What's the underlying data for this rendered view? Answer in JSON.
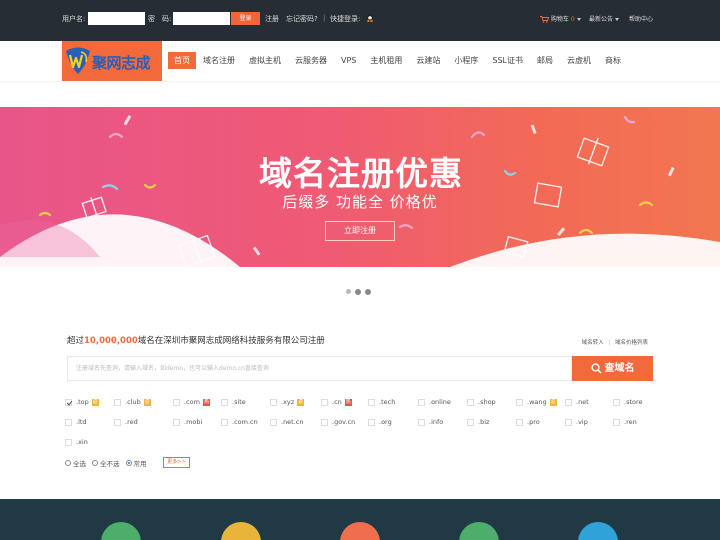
{
  "topbar": {
    "username_label": "用户名:",
    "password_label": "密　码:",
    "login_label": "登录",
    "register_label": "注册",
    "forgot_label": "忘记密码?",
    "quick_login_label": "快捷登录:",
    "cart_label": "购物车",
    "cart_count": "0",
    "notice_label": "最新公告",
    "help_label": "帮助中心"
  },
  "logo": {
    "text": "聚网志成"
  },
  "nav": {
    "items": [
      "首页",
      "域名注册",
      "虚拟主机",
      "云服务器",
      "VPS",
      "主机租用",
      "云建站",
      "小程序",
      "SSL证书",
      "邮局",
      "云虚机",
      "商标"
    ]
  },
  "banner": {
    "title": "域名注册优惠",
    "subtitle": "后缀多  功能全  价格优",
    "button": "立即注册"
  },
  "domain_search": {
    "intro_prefix": "超过",
    "intro_number": "10,000,000",
    "intro_suffix": "域名在深圳市聚网志成网络科技服务有限公司注册",
    "link_transfer": "域名转入",
    "link_prices": "域名价格列表",
    "placeholder": "注册域名先查询，请输入域名，如demo，也可以输入demo.cn直接查询",
    "button": "查域名"
  },
  "suffixes": [
    {
      "name": ".top",
      "badge": "返",
      "badge_color": "#f0b23a",
      "checked": true
    },
    {
      "name": ".club",
      "badge": "返",
      "badge_color": "#f0b23a",
      "checked": false
    },
    {
      "name": ".com",
      "badge": "热",
      "badge_color": "#e8554a",
      "checked": false
    },
    {
      "name": ".site",
      "badge": "",
      "checked": false
    },
    {
      "name": ".xyz",
      "badge": "返",
      "badge_color": "#f0b23a",
      "checked": false
    },
    {
      "name": ".cn",
      "badge": "热",
      "badge_color": "#e8554a",
      "checked": false
    },
    {
      "name": ".tech",
      "badge": "",
      "checked": false
    },
    {
      "name": ".online",
      "badge": "",
      "checked": false
    },
    {
      "name": ".shop",
      "badge": "",
      "checked": false
    },
    {
      "name": ".wang",
      "badge": "返",
      "badge_color": "#f0b23a",
      "checked": false
    },
    {
      "name": ".net",
      "badge": "",
      "checked": false
    },
    {
      "name": ".store",
      "badge": "",
      "checked": false
    },
    {
      "name": ".ltd",
      "badge": "",
      "checked": false
    },
    {
      "name": ".red",
      "badge": "",
      "checked": false
    },
    {
      "name": ".mobi",
      "badge": "",
      "checked": false
    },
    {
      "name": ".com.cn",
      "badge": "",
      "checked": false
    },
    {
      "name": ".net.cn",
      "badge": "",
      "checked": false
    },
    {
      "name": ".gov.cn",
      "badge": "",
      "checked": false
    },
    {
      "name": ".org",
      "badge": "",
      "checked": false
    },
    {
      "name": ".info",
      "badge": "",
      "checked": false
    },
    {
      "name": ".biz",
      "badge": "",
      "checked": false
    },
    {
      "name": ".pro",
      "badge": "",
      "checked": false
    },
    {
      "name": ".vip",
      "badge": "",
      "checked": false
    },
    {
      "name": ".ren",
      "badge": "",
      "checked": false
    },
    {
      "name": ".xin",
      "badge": "",
      "checked": false
    }
  ],
  "select_options": {
    "all": "全选",
    "none": "全不选",
    "common": "常用",
    "more": "更多>>"
  },
  "colors": {
    "accent": "#f26a3c",
    "topbar": "#272d34",
    "footer": "#1f3a45"
  }
}
